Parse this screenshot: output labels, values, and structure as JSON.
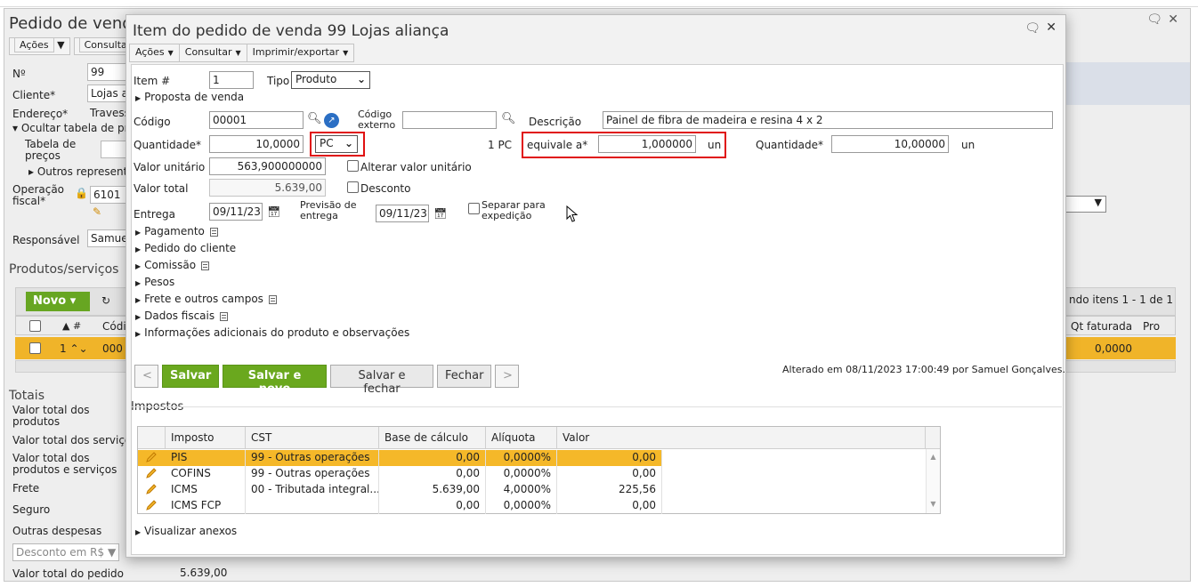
{
  "background": {
    "title": "Pedido de venda",
    "toolbar": [
      "Ações",
      "Consultar"
    ],
    "fields": {
      "numero_label": "Nº",
      "numero_value": "99",
      "cliente_label": "Cliente*",
      "cliente_value": "Lojas a",
      "endereco_label": "Endereço*",
      "endereco_value": "Travess",
      "ocultar_label": "Ocultar tabela de pre",
      "tabela_label": "Tabela de preços",
      "outros_label": "Outros representa",
      "operacao_label": "Operação fiscal*",
      "operacao_value": "6101",
      "responsavel_label": "Responsável",
      "responsavel_value": "Samuel"
    },
    "produtos_title": "Produtos/serviços",
    "novo_label": "Novo",
    "grid": {
      "paging": "ndo itens 1 - 1 de 1",
      "col_num": "#",
      "col_codigo": "Códi",
      "col_qtfaturada": "Qt faturada",
      "col_pro": "Pro",
      "row_num": "1",
      "row_code": "000",
      "row_qt": "0,0000"
    },
    "totais": {
      "title": "Totais",
      "produtos": "Valor total dos produtos",
      "servicos": "Valor total dos serviços",
      "prod_serv": "Valor total dos produtos e serviços",
      "frete": "Frete",
      "seguro": "Seguro",
      "outras": "Outras despesas",
      "desconto_select": "Desconto em R$",
      "pedido_label": "Valor total do pedido",
      "pedido_value": "5.639,00"
    }
  },
  "modal": {
    "title": "Item do pedido de venda 99 Lojas aliança",
    "toolbar": [
      "Ações",
      "Consultar",
      "Imprimir/exportar"
    ],
    "item_label": "Item #",
    "item_value": "1",
    "tipo_label": "Tipo",
    "tipo_value": "Produto",
    "proposta_label": "Proposta de venda",
    "codigo_label": "Código",
    "codigo_value": "00001",
    "codigo_externo_label": "Código externo",
    "codigo_externo_value": "",
    "descricao_label": "Descrição",
    "descricao_value": "Painel de fibra de madeira e resina 4 x 2",
    "quantidade_label": "Quantidade*",
    "quantidade_value": "10,0000",
    "unidade_value": "PC",
    "conv_prefix": "1 PC",
    "equivale_label": "equivale a*",
    "equivale_value": "1,000000",
    "equivale_unit": "un",
    "quantidade2_label": "Quantidade*",
    "quantidade2_value": "10,00000",
    "quantidade2_unit": "un",
    "valor_unitario_label": "Valor unitário",
    "valor_unitario_value": "563,900000000",
    "alterar_label": "Alterar valor unitário",
    "valor_total_label": "Valor total",
    "valor_total_value": "5.639,00",
    "desconto_label": "Desconto",
    "entrega_label": "Entrega",
    "entrega_value": "09/11/23",
    "previsao_label": "Previsão de entrega",
    "previsao_value": "09/11/23",
    "separar_label": "Separar para expedição",
    "sections": [
      "Pagamento",
      "Pedido do cliente",
      "Comissão",
      "Pesos",
      "Frete e outros campos",
      "Dados fiscais",
      "Informações adicionais do produto e observações"
    ],
    "buttons": {
      "prev": "<",
      "salvar": "Salvar",
      "salvar_novo": "Salvar e novo",
      "salvar_fechar": "Salvar e fechar",
      "fechar": "Fechar",
      "next": ">"
    },
    "altered": "Alterado em 08/11/2023 17:00:49 por Samuel Gonçalves.",
    "impostos_title": "Impostos",
    "tax_headers": [
      "Imposto",
      "CST",
      "Base de cálculo",
      "Alíquota",
      "Valor"
    ],
    "tax_rows": [
      {
        "imposto": "PIS",
        "cst": "99 - Outras operações",
        "base": "0,00",
        "aliquota": "0,0000%",
        "valor": "0,00"
      },
      {
        "imposto": "COFINS",
        "cst": "99 - Outras operações",
        "base": "0,00",
        "aliquota": "0,0000%",
        "valor": "0,00"
      },
      {
        "imposto": "ICMS",
        "cst": "00 - Tributada integral...",
        "base": "5.639,00",
        "aliquota": "4,0000%",
        "valor": "225,56"
      },
      {
        "imposto": "ICMS FCP",
        "cst": "",
        "base": "0,00",
        "aliquota": "0,0000%",
        "valor": "0,00"
      }
    ],
    "anexos_label": "Visualizar anexos"
  },
  "colors": {
    "green": "#6aa81e",
    "highlight_row": "#f5b829",
    "red_box": "#e01010"
  },
  "icons": [
    "search-icon",
    "link-icon",
    "calendar-icon",
    "pencil-icon",
    "chat-icon",
    "close-icon",
    "doc-icon",
    "mouse-cursor-icon"
  ]
}
